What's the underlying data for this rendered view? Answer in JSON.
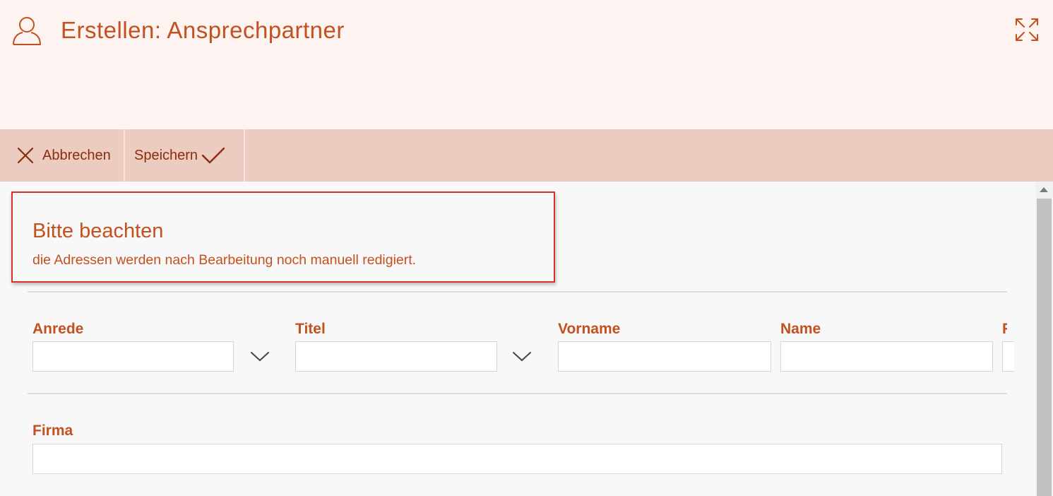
{
  "header": {
    "title": "Erstellen: Ansprechpartner",
    "user_icon": "user-icon",
    "expand_icon": "expand-icon"
  },
  "toolbar": {
    "cancel_label": "Abbrechen",
    "cancel_icon": "close-icon",
    "save_label": "Speichern",
    "save_icon": "checkmark-icon"
  },
  "notice": {
    "title": "Bitte beachten",
    "text": "die Adressen werden nach Bearbeitung noch manuell redigiert."
  },
  "form": {
    "anrede": {
      "label": "Anrede",
      "value": ""
    },
    "titel": {
      "label": "Titel",
      "value": ""
    },
    "vorname": {
      "label": "Vorname",
      "value": ""
    },
    "name": {
      "label": "Name",
      "value": ""
    },
    "truncated_label": "F",
    "firma": {
      "label": "Firma",
      "value": ""
    }
  },
  "colors": {
    "accent": "#c4501f",
    "header_bg": "#fdf3f0",
    "toolbar_bg": "#ecccc0",
    "toolbar_text": "#8a2d0c",
    "notice_border": "#d9302d"
  }
}
